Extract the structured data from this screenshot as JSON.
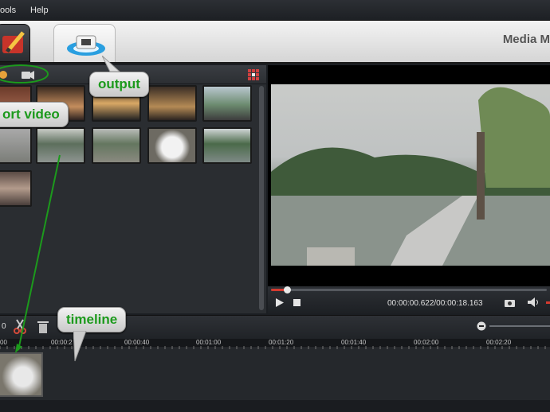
{
  "menu": {
    "tools": "ools",
    "help": "Help"
  },
  "app_title": "Media M",
  "callouts": {
    "output": "output",
    "import": "ort video",
    "timeline": "timeline"
  },
  "player": {
    "time": "00:00:00.622/00:00:18.163"
  },
  "timeline": {
    "counter": "0",
    "ticks": [
      "00",
      "00:00:2",
      "00:00:40",
      "00:01:00",
      "00:01:20",
      "00:01:40",
      "00:02:00",
      "00:02:20"
    ]
  }
}
